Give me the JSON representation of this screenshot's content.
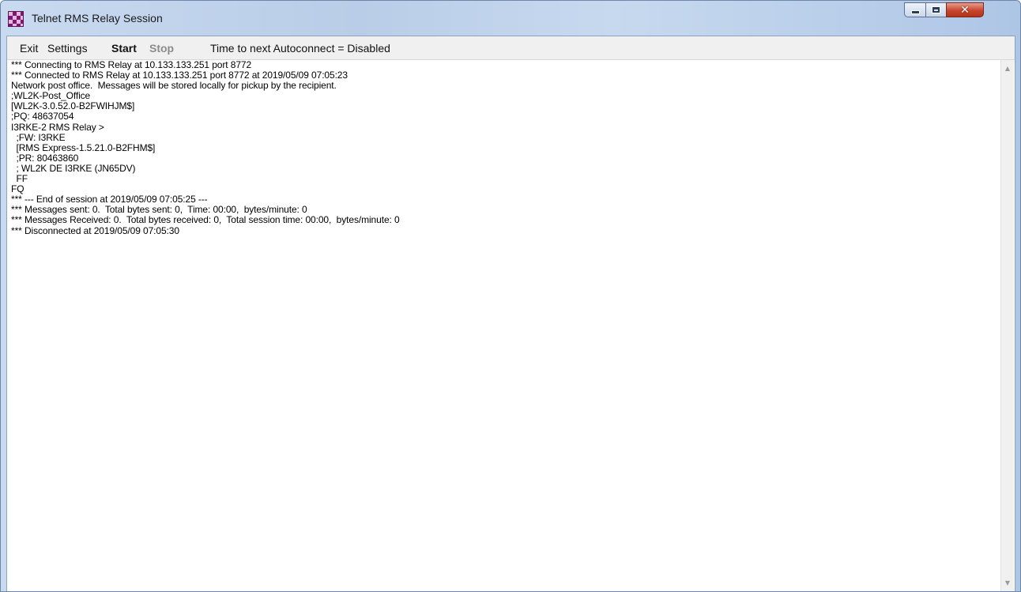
{
  "window": {
    "title": "Telnet RMS Relay Session",
    "icon": "checkered-app-icon",
    "controls": {
      "minimize": "minimize-icon",
      "maximize": "maximize-icon",
      "close": "close-icon",
      "close_glyph": "✕"
    }
  },
  "menu": {
    "exit": "Exit",
    "settings": "Settings",
    "start": "Start",
    "stop": "Stop",
    "autoconnect": "Time to next Autoconnect = Disabled"
  },
  "log": [
    "*** Connecting to RMS Relay at 10.133.133.251 port 8772",
    "*** Connected to RMS Relay at 10.133.133.251 port 8772 at 2019/05/09 07:05:23",
    "Network post office.  Messages will be stored locally for pickup by the recipient.",
    ";WL2K-Post_Office",
    "[WL2K-3.0.52.0-B2FWIHJM$]",
    ";PQ: 48637054",
    "I3RKE-2 RMS Relay >",
    "  ;FW: I3RKE",
    "  [RMS Express-1.5.21.0-B2FHM$]",
    "  ;PR: 80463860",
    "  ; WL2K DE I3RKE (JN65DV)",
    "  FF",
    "FQ",
    "*** --- End of session at 2019/05/09 07:05:25 ---",
    "*** Messages sent: 0.  Total bytes sent: 0,  Time: 00:00,  bytes/minute: 0",
    "*** Messages Received: 0.  Total bytes received: 0,  Total session time: 00:00,  bytes/minute: 0",
    "*** Disconnected at 2019/05/09 07:05:30"
  ],
  "scrollbar": {
    "up_arrow": "▲",
    "down_arrow": "▼"
  },
  "colors": {
    "stop_disabled": "#8c8c8c",
    "close_button": "#c8452d"
  }
}
